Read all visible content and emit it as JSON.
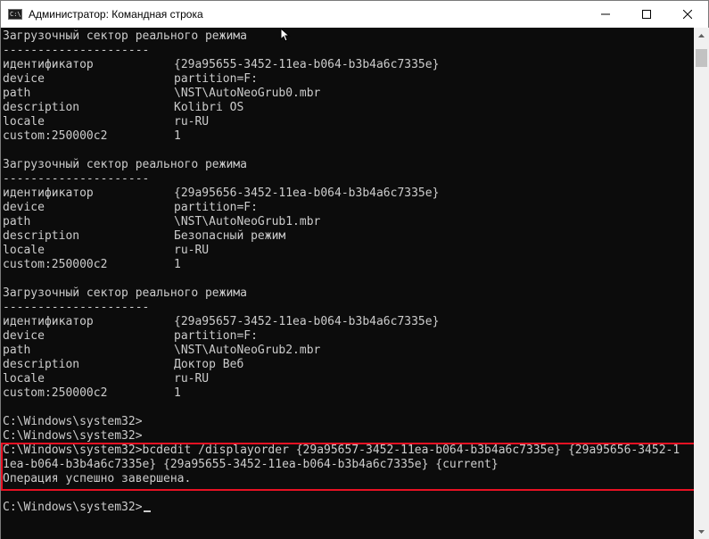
{
  "window": {
    "title": "Администратор: Командная строка",
    "app_icon_text": "C:\\",
    "app_icon": "cmd-icon",
    "minimize_icon": "minimize-icon",
    "maximize_icon": "maximize-icon",
    "close_icon": "close-icon"
  },
  "console": {
    "entries": [
      {
        "header": "Загрузочный сектор реального режима",
        "separator": "---------------------",
        "rows": [
          {
            "key": "идентификатор",
            "value": "{29a95655-3452-11ea-b064-b3b4a6c7335e}"
          },
          {
            "key": "device",
            "value": "partition=F:"
          },
          {
            "key": "path",
            "value": "\\NST\\AutoNeoGrub0.mbr"
          },
          {
            "key": "description",
            "value": "Kolibri OS"
          },
          {
            "key": "locale",
            "value": "ru-RU"
          },
          {
            "key": "custom:250000c2",
            "value": "1"
          }
        ]
      },
      {
        "header": "Загрузочный сектор реального режима",
        "separator": "---------------------",
        "rows": [
          {
            "key": "идентификатор",
            "value": "{29a95656-3452-11ea-b064-b3b4a6c7335e}"
          },
          {
            "key": "device",
            "value": "partition=F:"
          },
          {
            "key": "path",
            "value": "\\NST\\AutoNeoGrub1.mbr"
          },
          {
            "key": "description",
            "value": "Безопасный режим"
          },
          {
            "key": "locale",
            "value": "ru-RU"
          },
          {
            "key": "custom:250000c2",
            "value": "1"
          }
        ]
      },
      {
        "header": "Загрузочный сектор реального режима",
        "separator": "---------------------",
        "rows": [
          {
            "key": "идентификатор",
            "value": "{29a95657-3452-11ea-b064-b3b4a6c7335e}"
          },
          {
            "key": "device",
            "value": "partition=F:"
          },
          {
            "key": "path",
            "value": "\\NST\\AutoNeoGrub2.mbr"
          },
          {
            "key": "description",
            "value": "Доктор Веб"
          },
          {
            "key": "locale",
            "value": "ru-RU"
          },
          {
            "key": "custom:250000c2",
            "value": "1"
          }
        ]
      }
    ],
    "prompt_lines": [
      "C:\\Windows\\system32>",
      "C:\\Windows\\system32>"
    ],
    "command_lines": [
      "C:\\Windows\\system32>bcdedit /displayorder {29a95657-3452-11ea-b064-b3b4a6c7335e} {29a95656-3452-1",
      "1ea-b064-b3b4a6c7335e} {29a95655-3452-11ea-b064-b3b4a6c7335e} {current}",
      "Операция успешно завершена."
    ],
    "final_prompt": "C:\\Windows\\system32>"
  },
  "colors": {
    "console_bg": "#0c0c0c",
    "console_text": "#cccccc",
    "highlight_border": "#e81123"
  }
}
